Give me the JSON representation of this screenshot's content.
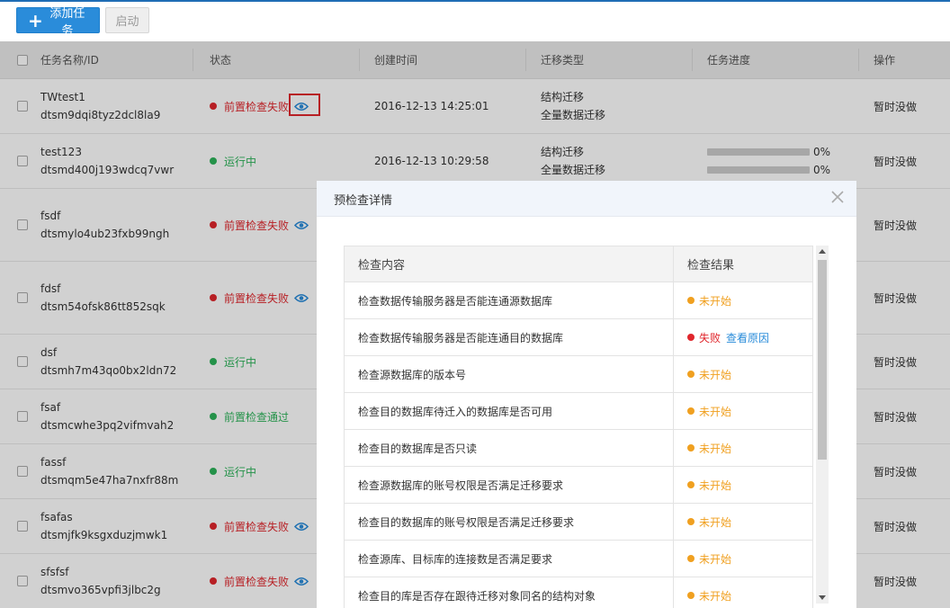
{
  "toolbar": {
    "add_label": "添加任务",
    "start_label": "启动"
  },
  "columns": [
    "任务名称/ID",
    "状态",
    "创建时间",
    "迁移类型",
    "任务进度",
    "操作"
  ],
  "rows": [
    {
      "name": "TWtest1",
      "id": "dtsm9dqi8tyz2dcl8la9",
      "status": "前置检查失败",
      "status_kind": "fail",
      "eye": true,
      "created": "2016-12-13 14:25:01",
      "types": [
        "结构迁移",
        "全量数据迁移"
      ],
      "progress": [],
      "ops": "暂时没做"
    },
    {
      "name": "test123",
      "id": "dtsmd400j193wdcq7vwr",
      "status": "运行中",
      "status_kind": "ok",
      "eye": false,
      "created": "2016-12-13 10:29:58",
      "types": [
        "结构迁移",
        "全量数据迁移"
      ],
      "progress": [
        "0%",
        "0%"
      ],
      "ops": "暂时没做"
    },
    {
      "name": "fsdf",
      "id": "dtsmylo4ub23fxb99ngh",
      "status": "前置检查失败",
      "status_kind": "fail",
      "eye": true,
      "created": "",
      "types": [],
      "progress": [],
      "ops": "暂时没做"
    },
    {
      "name": "fdsf",
      "id": "dtsm54ofsk86tt852sqk",
      "status": "前置检查失败",
      "status_kind": "fail",
      "eye": true,
      "created": "",
      "types": [],
      "progress": [],
      "ops": "暂时没做"
    },
    {
      "name": "dsf",
      "id": "dtsmh7m43qo0bx2ldn72",
      "status": "运行中",
      "status_kind": "ok",
      "eye": false,
      "created": "",
      "types": [],
      "progress": [],
      "ops": "暂时没做"
    },
    {
      "name": "fsaf",
      "id": "dtsmcwhe3pq2vifmvah2",
      "status": "前置检查通过",
      "status_kind": "ok",
      "eye": false,
      "created": "",
      "types": [],
      "progress": [],
      "ops": "暂时没做"
    },
    {
      "name": "fassf",
      "id": "dtsmqm5e47ha7nxfr88m",
      "status": "运行中",
      "status_kind": "ok",
      "eye": false,
      "created": "",
      "types": [],
      "progress": [],
      "ops": "暂时没做"
    },
    {
      "name": "fsafas",
      "id": "dtsmjfk9ksgxduzjmwk1",
      "status": "前置检查失败",
      "status_kind": "fail",
      "eye": true,
      "created": "",
      "types": [],
      "progress": [],
      "ops": "暂时没做"
    },
    {
      "name": "sfsfsf",
      "id": "dtsmvo365vpfi3jlbc2g",
      "status": "前置检查失败",
      "status_kind": "fail",
      "eye": true,
      "created": "",
      "types": [],
      "progress": [],
      "ops": "暂时没做"
    }
  ],
  "modal": {
    "title": "预检查详情",
    "col_content": "检查内容",
    "col_result": "检查结果",
    "items": [
      {
        "content": "检查数据传输服务器是否能连通源数据库",
        "result": "未开始",
        "kind": "pending",
        "link": ""
      },
      {
        "content": "检查数据传输服务器是否能连通目的数据库",
        "result": "失败",
        "kind": "failed",
        "link": "查看原因"
      },
      {
        "content": "检查源数据库的版本号",
        "result": "未开始",
        "kind": "pending",
        "link": ""
      },
      {
        "content": "检查目的数据库待迁入的数据库是否可用",
        "result": "未开始",
        "kind": "pending",
        "link": ""
      },
      {
        "content": "检查目的数据库是否只读",
        "result": "未开始",
        "kind": "pending",
        "link": ""
      },
      {
        "content": "检查源数据库的账号权限是否满足迁移要求",
        "result": "未开始",
        "kind": "pending",
        "link": ""
      },
      {
        "content": "检查目的数据库的账号权限是否满足迁移要求",
        "result": "未开始",
        "kind": "pending",
        "link": ""
      },
      {
        "content": "检查源库、目标库的连接数是否满足要求",
        "result": "未开始",
        "kind": "pending",
        "link": ""
      },
      {
        "content": "检查目的库是否存在跟待迁移对象同名的结构对象",
        "result": "未开始",
        "kind": "pending",
        "link": ""
      }
    ]
  },
  "colors": {
    "primary": "#2a8cda",
    "ok": "#2db35a",
    "fail": "#e0262c",
    "pending": "#f0a020",
    "eye": "#2a8cda"
  }
}
